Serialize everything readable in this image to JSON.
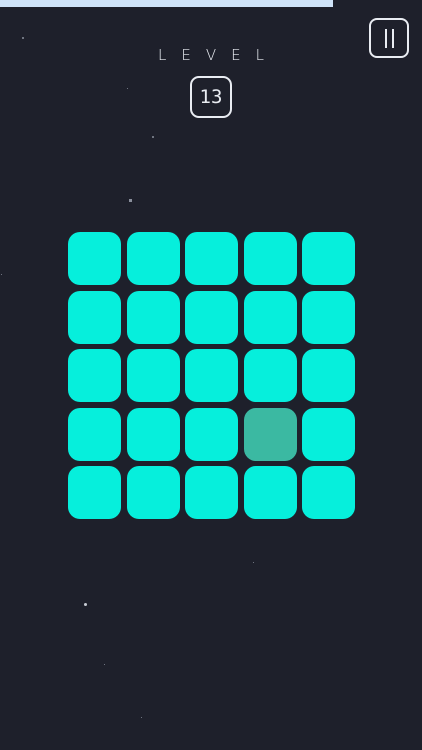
{
  "header": {
    "level_label": "LEVEL",
    "level_number": "13",
    "timer_progress": 0.79
  },
  "icons": {
    "pause": "pause-icon"
  },
  "colors": {
    "background": "#1e202b",
    "tile_active": "#06efdc",
    "tile_dim": "#3bb9a2",
    "timer": "#cfe3f8",
    "outline": "#e9ecf2"
  },
  "board": {
    "rows": 5,
    "cols": 5,
    "tiles": [
      [
        "on",
        "on",
        "on",
        "on",
        "on"
      ],
      [
        "on",
        "on",
        "on",
        "on",
        "on"
      ],
      [
        "on",
        "on",
        "on",
        "on",
        "on"
      ],
      [
        "on",
        "on",
        "on",
        "off",
        "on"
      ],
      [
        "on",
        "on",
        "on",
        "on",
        "on"
      ]
    ]
  }
}
